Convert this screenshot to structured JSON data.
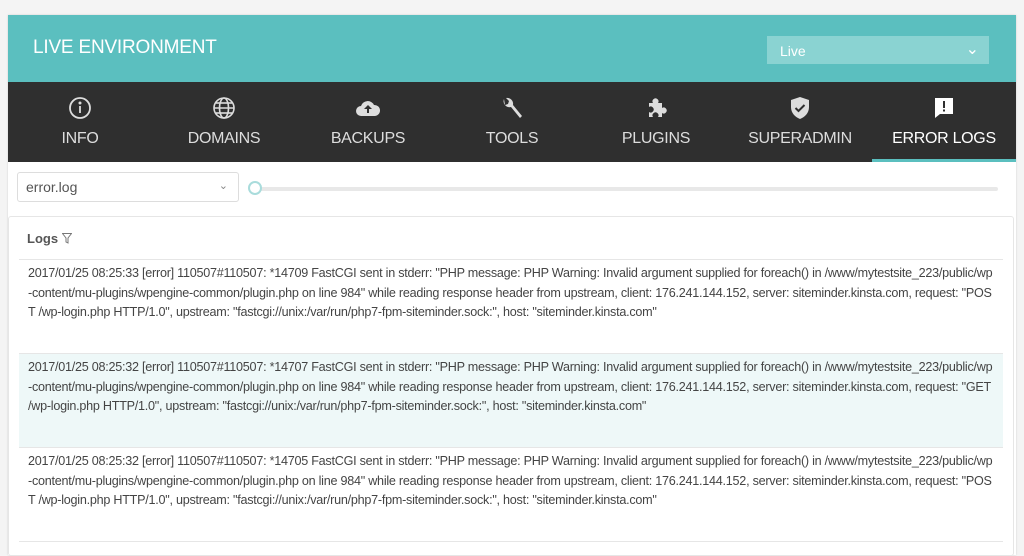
{
  "header": {
    "title": "LIVE ENVIRONMENT",
    "environment_select": "Live"
  },
  "nav": {
    "tabs": [
      {
        "label": "INFO",
        "icon": "info-icon"
      },
      {
        "label": "DOMAINS",
        "icon": "globe-icon"
      },
      {
        "label": "BACKUPS",
        "icon": "cloud-upload-icon"
      },
      {
        "label": "TOOLS",
        "icon": "wrench-icon"
      },
      {
        "label": "PLUGINS",
        "icon": "puzzle-icon"
      },
      {
        "label": "SUPERADMIN",
        "icon": "shield-check-icon"
      },
      {
        "label": "ERROR LOGS",
        "icon": "alert-message-icon",
        "active": true
      }
    ]
  },
  "controls": {
    "log_file": "error.log",
    "slider_value": 0
  },
  "logs": {
    "title": "Logs",
    "entries": [
      "2017/01/25 08:25:33 [error] 110507#110507: *14709 FastCGI sent in stderr: \"PHP message: PHP Warning: Invalid argument supplied for foreach() in /www/mytestsite_223/public/wp-content/mu-plugins/wpengine-common/plugin.php on line 984\" while reading response header from upstream, client: 176.241.144.152, server: siteminder.kinsta.com, request: \"POST /wp-login.php HTTP/1.0\", upstream: \"fastcgi://unix:/var/run/php7-fpm-siteminder.sock:\", host: \"siteminder.kinsta.com\"",
      "2017/01/25 08:25:32 [error] 110507#110507: *14707 FastCGI sent in stderr: \"PHP message: PHP Warning: Invalid argument supplied for foreach() in /www/mytestsite_223/public/wp-content/mu-plugins/wpengine-common/plugin.php on line 984\" while reading response header from upstream, client: 176.241.144.152, server: siteminder.kinsta.com, request: \"GET /wp-login.php HTTP/1.0\", upstream: \"fastcgi://unix:/var/run/php7-fpm-siteminder.sock:\", host: \"siteminder.kinsta.com\"",
      "2017/01/25 08:25:32 [error] 110507#110507: *14705 FastCGI sent in stderr: \"PHP message: PHP Warning: Invalid argument supplied for foreach() in /www/mytestsite_223/public/wp-content/mu-plugins/wpengine-common/plugin.php on line 984\" while reading response header from upstream, client: 176.241.144.152, server: siteminder.kinsta.com, request: \"POST /wp-login.php HTTP/1.0\", upstream: \"fastcgi://unix:/var/run/php7-fpm-siteminder.sock:\", host: \"siteminder.kinsta.com\""
    ]
  },
  "colors": {
    "accent": "#5bbfbf",
    "nav_bg": "#2f2f2f",
    "highlight_row": "#eef8f8"
  }
}
